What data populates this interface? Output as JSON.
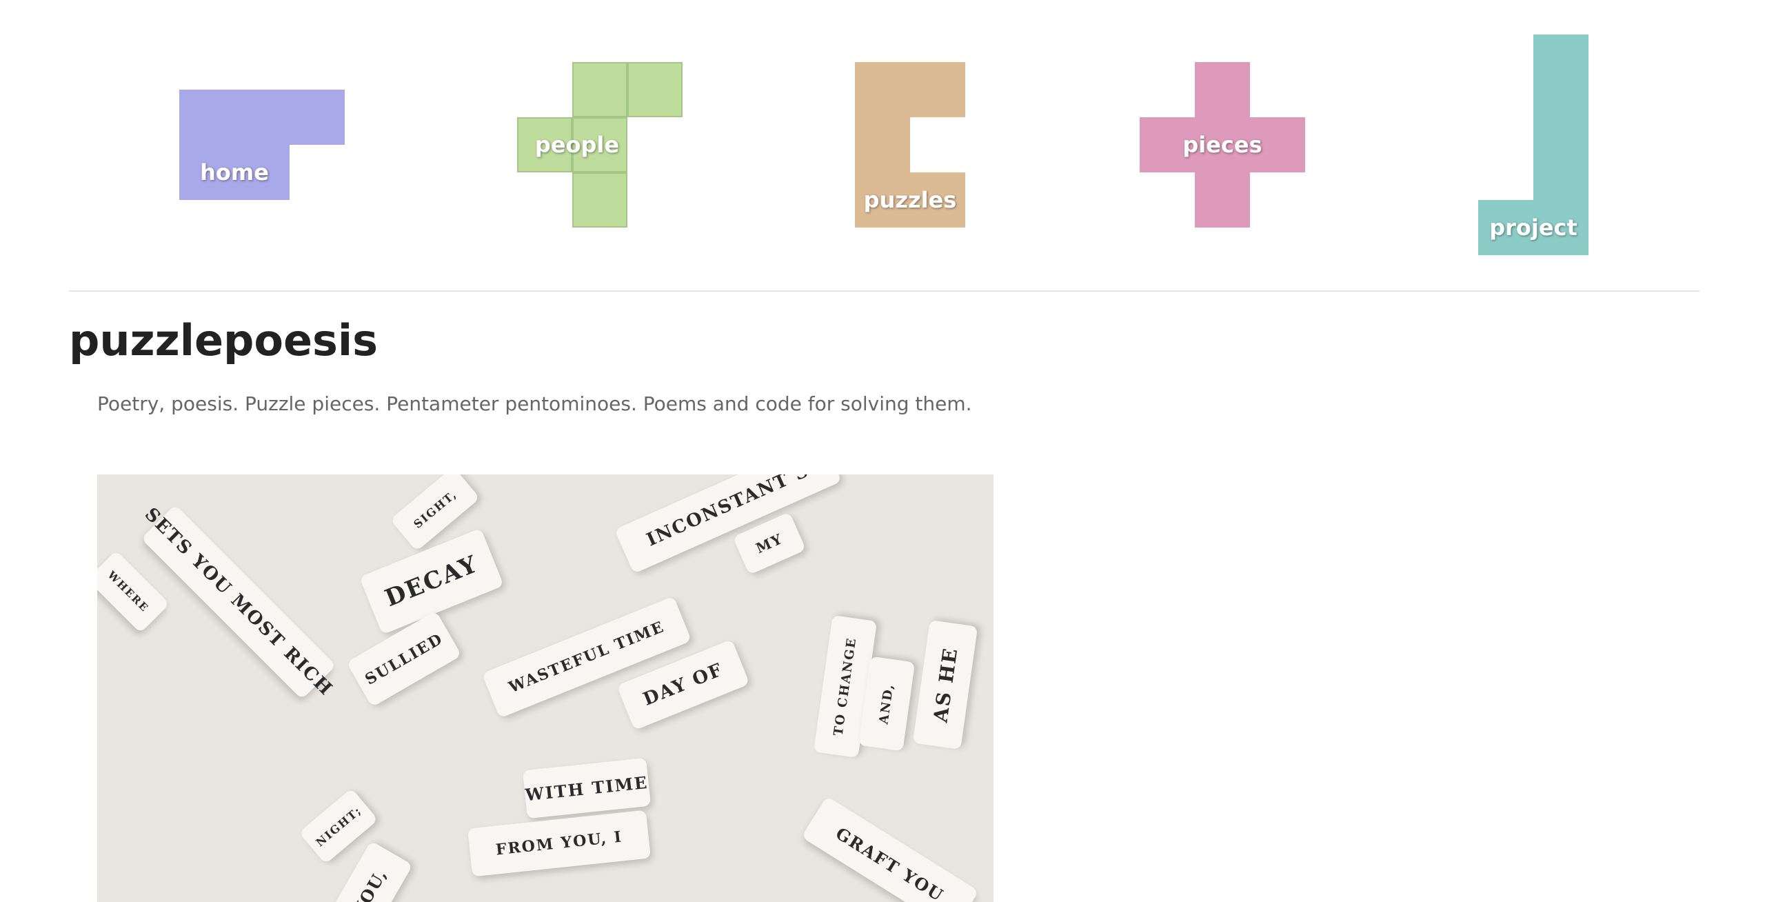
{
  "nav": [
    {
      "label": "home",
      "color": "#a9a8e8"
    },
    {
      "label": "people",
      "color": "#bedc9c"
    },
    {
      "label": "puzzles",
      "color": "#dcbb94"
    },
    {
      "label": "pieces",
      "color": "#dd9aba"
    },
    {
      "label": "project",
      "color": "#8bccc7"
    }
  ],
  "page": {
    "title": "puzzlepoesis",
    "tagline": "Poetry, poesis. Puzzle pieces. Pentameter pentominoes. Poems and code for solving them."
  },
  "photo_words": [
    "Sets you most rich",
    "Where",
    "sight,",
    "Decay",
    "sullied",
    "inconstant s",
    "my",
    "wasteful Time",
    "day of",
    "To change",
    "And,",
    "As he",
    "with Time",
    "from you, I",
    "night;",
    "you,",
    "graft you"
  ]
}
